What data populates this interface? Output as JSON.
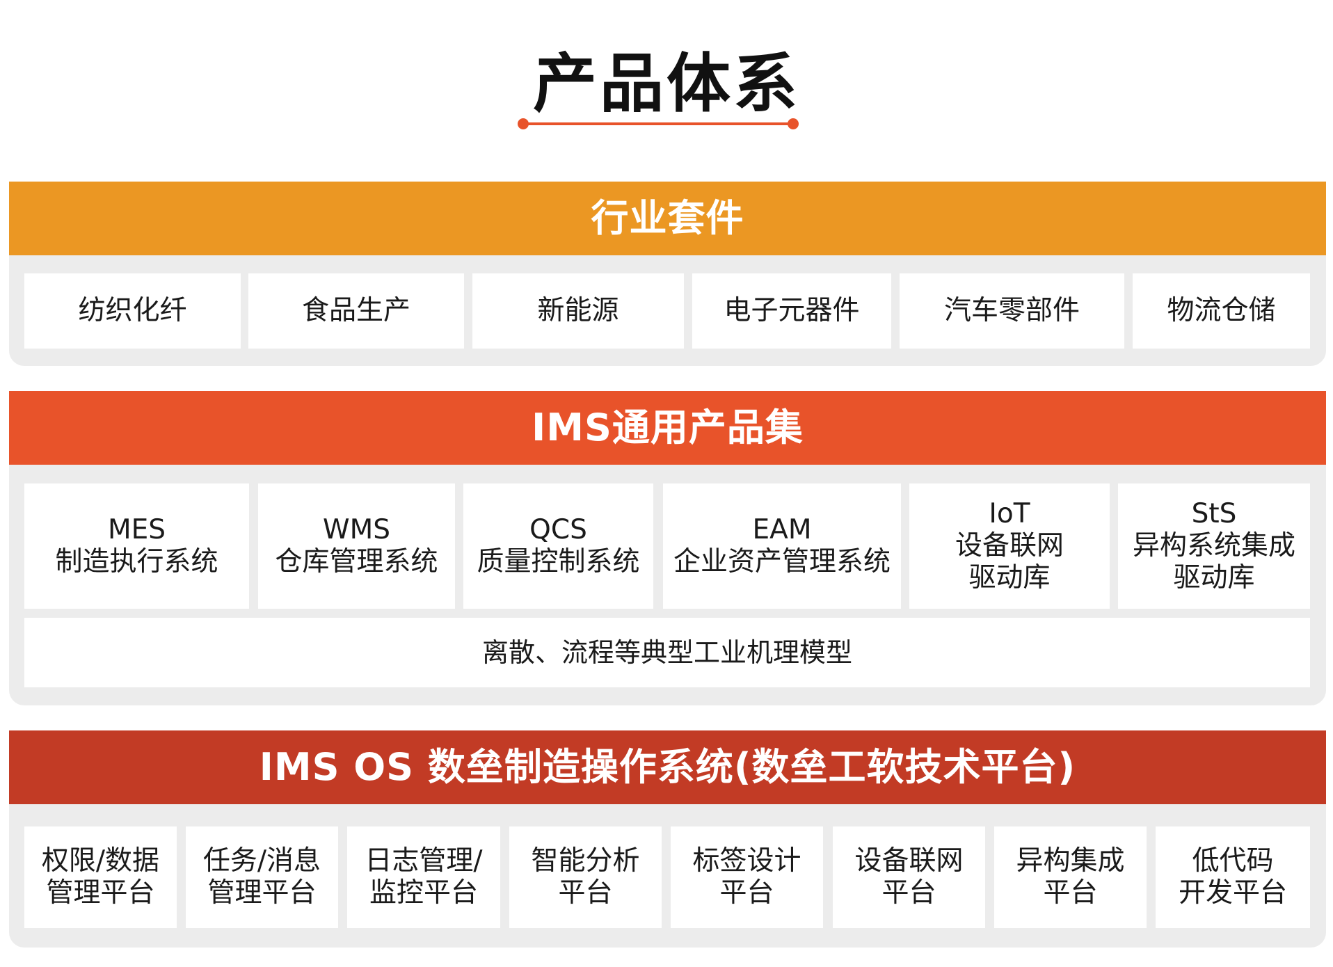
{
  "title": "产品体系",
  "colors": {
    "accent": "#e8532a",
    "industry_header": "#eb9723",
    "ims_header": "#e8532a",
    "os_header": "#c23b25",
    "panel_bg": "#ececec"
  },
  "industry": {
    "header": "行业套件",
    "items": [
      "纺织化纤",
      "食品生产",
      "新能源",
      "电子元器件",
      "汽车零部件",
      "物流仓储"
    ]
  },
  "ims": {
    "header": "IMS通用产品集",
    "items": [
      {
        "line1": "MES",
        "line2": "制造执行系统",
        "line3": ""
      },
      {
        "line1": "WMS",
        "line2": "仓库管理系统",
        "line3": ""
      },
      {
        "line1": "QCS",
        "line2": "质量控制系统",
        "line3": ""
      },
      {
        "line1": "EAM",
        "line2": "企业资产管理系统",
        "line3": ""
      },
      {
        "line1": "IoT",
        "line2": "设备联网",
        "line3": "驱动库"
      },
      {
        "line1": "StS",
        "line2": "异构系统集成",
        "line3": "驱动库"
      }
    ],
    "model_bar": "离散、流程等典型工业机理模型"
  },
  "os": {
    "header": "IMS OS 数垒制造操作系统(数垒工软技术平台)",
    "items": [
      {
        "line1": "权限/数据",
        "line2": "管理平台"
      },
      {
        "line1": "任务/消息",
        "line2": "管理平台"
      },
      {
        "line1": "日志管理/",
        "line2": "监控平台"
      },
      {
        "line1": "智能分析",
        "line2": "平台"
      },
      {
        "line1": "标签设计",
        "line2": "平台"
      },
      {
        "line1": "设备联网",
        "line2": "平台"
      },
      {
        "line1": "异构集成",
        "line2": "平台"
      },
      {
        "line1": "低代码",
        "line2": "开发平台"
      }
    ]
  }
}
